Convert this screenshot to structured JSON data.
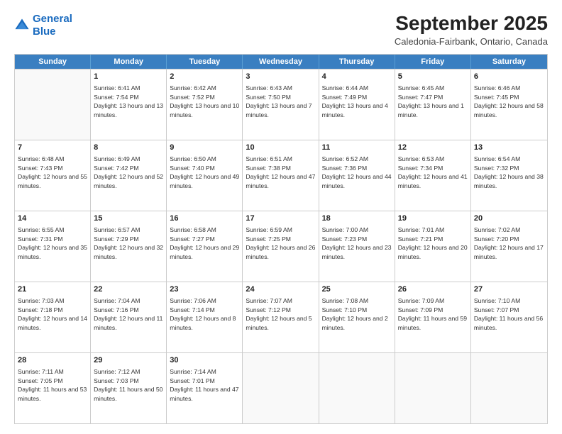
{
  "logo": {
    "line1": "General",
    "line2": "Blue"
  },
  "title": "September 2025",
  "subtitle": "Caledonia-Fairbank, Ontario, Canada",
  "days": [
    "Sunday",
    "Monday",
    "Tuesday",
    "Wednesday",
    "Thursday",
    "Friday",
    "Saturday"
  ],
  "weeks": [
    [
      {
        "day": "",
        "sunrise": "",
        "sunset": "",
        "daylight": ""
      },
      {
        "day": "1",
        "sunrise": "6:41 AM",
        "sunset": "7:54 PM",
        "daylight": "13 hours and 13 minutes."
      },
      {
        "day": "2",
        "sunrise": "6:42 AM",
        "sunset": "7:52 PM",
        "daylight": "13 hours and 10 minutes."
      },
      {
        "day": "3",
        "sunrise": "6:43 AM",
        "sunset": "7:50 PM",
        "daylight": "13 hours and 7 minutes."
      },
      {
        "day": "4",
        "sunrise": "6:44 AM",
        "sunset": "7:49 PM",
        "daylight": "13 hours and 4 minutes."
      },
      {
        "day": "5",
        "sunrise": "6:45 AM",
        "sunset": "7:47 PM",
        "daylight": "13 hours and 1 minute."
      },
      {
        "day": "6",
        "sunrise": "6:46 AM",
        "sunset": "7:45 PM",
        "daylight": "12 hours and 58 minutes."
      }
    ],
    [
      {
        "day": "7",
        "sunrise": "6:48 AM",
        "sunset": "7:43 PM",
        "daylight": "12 hours and 55 minutes."
      },
      {
        "day": "8",
        "sunrise": "6:49 AM",
        "sunset": "7:42 PM",
        "daylight": "12 hours and 52 minutes."
      },
      {
        "day": "9",
        "sunrise": "6:50 AM",
        "sunset": "7:40 PM",
        "daylight": "12 hours and 49 minutes."
      },
      {
        "day": "10",
        "sunrise": "6:51 AM",
        "sunset": "7:38 PM",
        "daylight": "12 hours and 47 minutes."
      },
      {
        "day": "11",
        "sunrise": "6:52 AM",
        "sunset": "7:36 PM",
        "daylight": "12 hours and 44 minutes."
      },
      {
        "day": "12",
        "sunrise": "6:53 AM",
        "sunset": "7:34 PM",
        "daylight": "12 hours and 41 minutes."
      },
      {
        "day": "13",
        "sunrise": "6:54 AM",
        "sunset": "7:32 PM",
        "daylight": "12 hours and 38 minutes."
      }
    ],
    [
      {
        "day": "14",
        "sunrise": "6:55 AM",
        "sunset": "7:31 PM",
        "daylight": "12 hours and 35 minutes."
      },
      {
        "day": "15",
        "sunrise": "6:57 AM",
        "sunset": "7:29 PM",
        "daylight": "12 hours and 32 minutes."
      },
      {
        "day": "16",
        "sunrise": "6:58 AM",
        "sunset": "7:27 PM",
        "daylight": "12 hours and 29 minutes."
      },
      {
        "day": "17",
        "sunrise": "6:59 AM",
        "sunset": "7:25 PM",
        "daylight": "12 hours and 26 minutes."
      },
      {
        "day": "18",
        "sunrise": "7:00 AM",
        "sunset": "7:23 PM",
        "daylight": "12 hours and 23 minutes."
      },
      {
        "day": "19",
        "sunrise": "7:01 AM",
        "sunset": "7:21 PM",
        "daylight": "12 hours and 20 minutes."
      },
      {
        "day": "20",
        "sunrise": "7:02 AM",
        "sunset": "7:20 PM",
        "daylight": "12 hours and 17 minutes."
      }
    ],
    [
      {
        "day": "21",
        "sunrise": "7:03 AM",
        "sunset": "7:18 PM",
        "daylight": "12 hours and 14 minutes."
      },
      {
        "day": "22",
        "sunrise": "7:04 AM",
        "sunset": "7:16 PM",
        "daylight": "12 hours and 11 minutes."
      },
      {
        "day": "23",
        "sunrise": "7:06 AM",
        "sunset": "7:14 PM",
        "daylight": "12 hours and 8 minutes."
      },
      {
        "day": "24",
        "sunrise": "7:07 AM",
        "sunset": "7:12 PM",
        "daylight": "12 hours and 5 minutes."
      },
      {
        "day": "25",
        "sunrise": "7:08 AM",
        "sunset": "7:10 PM",
        "daylight": "12 hours and 2 minutes."
      },
      {
        "day": "26",
        "sunrise": "7:09 AM",
        "sunset": "7:09 PM",
        "daylight": "11 hours and 59 minutes."
      },
      {
        "day": "27",
        "sunrise": "7:10 AM",
        "sunset": "7:07 PM",
        "daylight": "11 hours and 56 minutes."
      }
    ],
    [
      {
        "day": "28",
        "sunrise": "7:11 AM",
        "sunset": "7:05 PM",
        "daylight": "11 hours and 53 minutes."
      },
      {
        "day": "29",
        "sunrise": "7:12 AM",
        "sunset": "7:03 PM",
        "daylight": "11 hours and 50 minutes."
      },
      {
        "day": "30",
        "sunrise": "7:14 AM",
        "sunset": "7:01 PM",
        "daylight": "11 hours and 47 minutes."
      },
      {
        "day": "",
        "sunrise": "",
        "sunset": "",
        "daylight": ""
      },
      {
        "day": "",
        "sunrise": "",
        "sunset": "",
        "daylight": ""
      },
      {
        "day": "",
        "sunrise": "",
        "sunset": "",
        "daylight": ""
      },
      {
        "day": "",
        "sunrise": "",
        "sunset": "",
        "daylight": ""
      }
    ]
  ]
}
